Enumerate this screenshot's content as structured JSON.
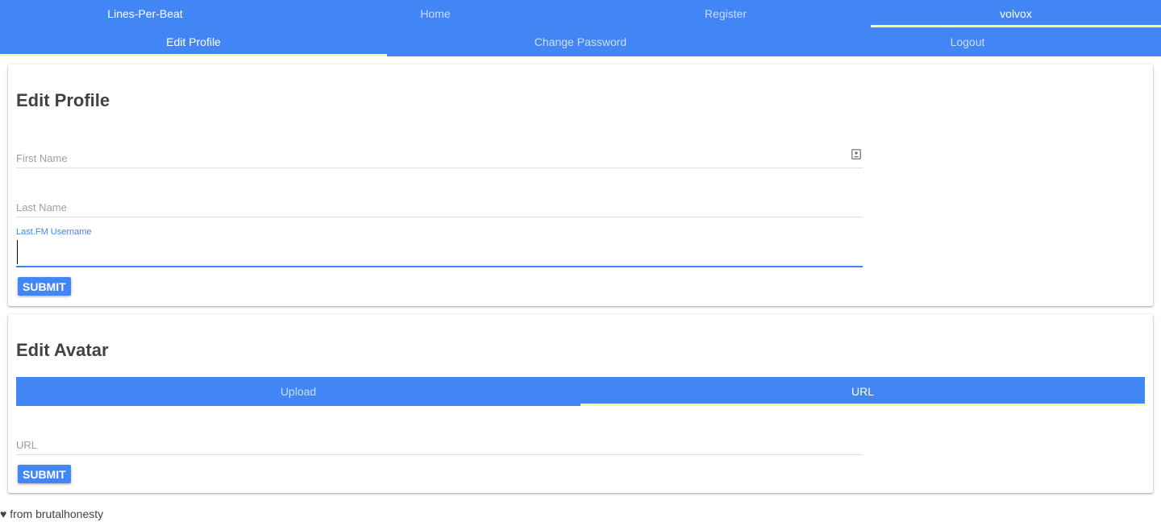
{
  "nav": {
    "brand": "Lines-Per-Beat",
    "items": [
      {
        "label": "Home"
      },
      {
        "label": "Register"
      },
      {
        "label": "volvox"
      }
    ]
  },
  "subnav": {
    "items": [
      {
        "label": "Edit Profile"
      },
      {
        "label": "Change Password"
      },
      {
        "label": "Logout"
      }
    ]
  },
  "profile": {
    "title": "Edit Profile",
    "first_name_label": "First Name",
    "last_name_label": "Last Name",
    "lastfm_label": "Last.FM Username",
    "lastfm_value": "",
    "submit_label": "SUBMIT"
  },
  "avatar": {
    "title": "Edit Avatar",
    "tabs": [
      {
        "label": "Upload"
      },
      {
        "label": "URL"
      }
    ],
    "url_label": "URL",
    "submit_label": "SUBMIT"
  },
  "footer": {
    "text": "♥ from brutalhonesty"
  },
  "colors": {
    "primary": "#4285f4",
    "tab_indicator": "#ffff8d"
  },
  "icons": {
    "first_name_field": "contact-card-icon",
    "footer_heart": "heart-icon"
  }
}
